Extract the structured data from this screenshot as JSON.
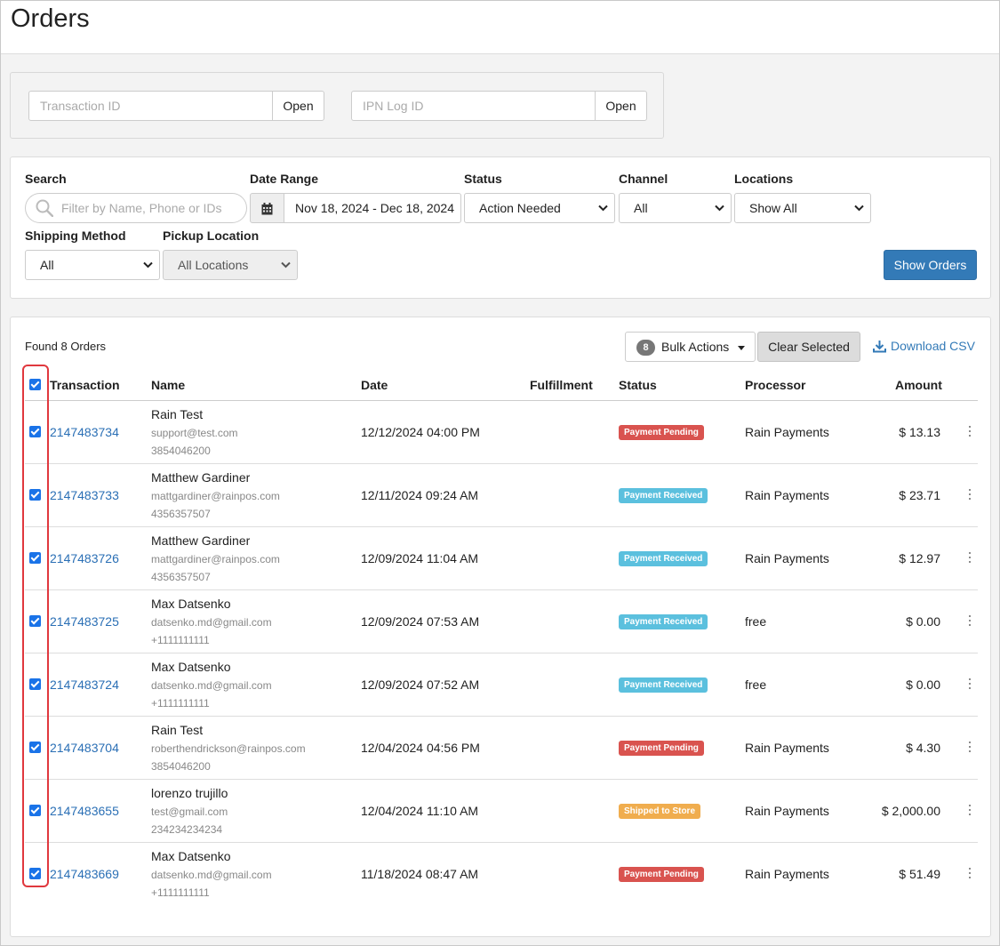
{
  "page": {
    "title": "Orders"
  },
  "lookup": {
    "transaction_placeholder": "Transaction ID",
    "transaction_button": "Open",
    "ipn_placeholder": "IPN Log ID",
    "ipn_button": "Open"
  },
  "filters": {
    "search_label": "Search",
    "search_placeholder": "Filter by Name, Phone or IDs",
    "date_label": "Date Range",
    "date_value": "Nov 18, 2024 - Dec 18, 2024",
    "status_label": "Status",
    "status_value": "Action Needed",
    "channel_label": "Channel",
    "channel_value": "All",
    "locations_label": "Locations",
    "locations_value": "Show All",
    "shipping_label": "Shipping Method",
    "shipping_value": "All",
    "pickup_label": "Pickup Location",
    "pickup_value": "All Locations",
    "show_button": "Show Orders"
  },
  "orders": {
    "found_text": "Found 8 Orders",
    "bulk_count": "8",
    "bulk_label": "Bulk Actions",
    "clear_label": "Clear Selected",
    "csv_label": "Download CSV",
    "columns": {
      "transaction": "Transaction",
      "name": "Name",
      "date": "Date",
      "fulfillment": "Fulfillment",
      "status": "Status",
      "processor": "Processor",
      "amount": "Amount"
    },
    "rows": [
      {
        "id": "2147483734",
        "name": "Rain Test",
        "email": "support@test.com",
        "phone": "3854046200",
        "date": "12/12/2024 04:00 PM",
        "status": "Payment Pending",
        "processor": "Rain Payments",
        "amount": "$ 13.13"
      },
      {
        "id": "2147483733",
        "name": "Matthew Gardiner",
        "email": "mattgardiner@rainpos.com",
        "phone": "4356357507",
        "date": "12/11/2024 09:24 AM",
        "status": "Payment Received",
        "processor": "Rain Payments",
        "amount": "$ 23.71"
      },
      {
        "id": "2147483726",
        "name": "Matthew Gardiner",
        "email": "mattgardiner@rainpos.com",
        "phone": "4356357507",
        "date": "12/09/2024 11:04 AM",
        "status": "Payment Received",
        "processor": "Rain Payments",
        "amount": "$ 12.97"
      },
      {
        "id": "2147483725",
        "name": "Max Datsenko",
        "email": "datsenko.md@gmail.com",
        "phone": "+1111111111",
        "date": "12/09/2024 07:53 AM",
        "status": "Payment Received",
        "processor": "free",
        "amount": "$ 0.00"
      },
      {
        "id": "2147483724",
        "name": "Max Datsenko",
        "email": "datsenko.md@gmail.com",
        "phone": "+1111111111",
        "date": "12/09/2024 07:52 AM",
        "status": "Payment Received",
        "processor": "free",
        "amount": "$ 0.00"
      },
      {
        "id": "2147483704",
        "name": "Rain Test",
        "email": "roberthendrickson@rainpos.com",
        "phone": "3854046200",
        "date": "12/04/2024 04:56 PM",
        "status": "Payment Pending",
        "processor": "Rain Payments",
        "amount": "$ 4.30"
      },
      {
        "id": "2147483655",
        "name": "lorenzo trujillo",
        "email": "test@gmail.com",
        "phone": "234234234234",
        "date": "12/04/2024 11:10 AM",
        "status": "Shipped to Store",
        "processor": "Rain Payments",
        "amount": "$ 2,000.00"
      },
      {
        "id": "2147483669",
        "name": "Max Datsenko",
        "email": "datsenko.md@gmail.com",
        "phone": "+1111111111",
        "date": "11/18/2024 08:47 AM",
        "status": "Payment Pending",
        "processor": "Rain Payments",
        "amount": "$ 51.49"
      }
    ]
  },
  "colors": {
    "pending": "#d9534f",
    "received": "#5bc0de",
    "shipped": "#f0ad4e",
    "primary": "#337ab7",
    "selection_highlight": "#e0383e"
  }
}
